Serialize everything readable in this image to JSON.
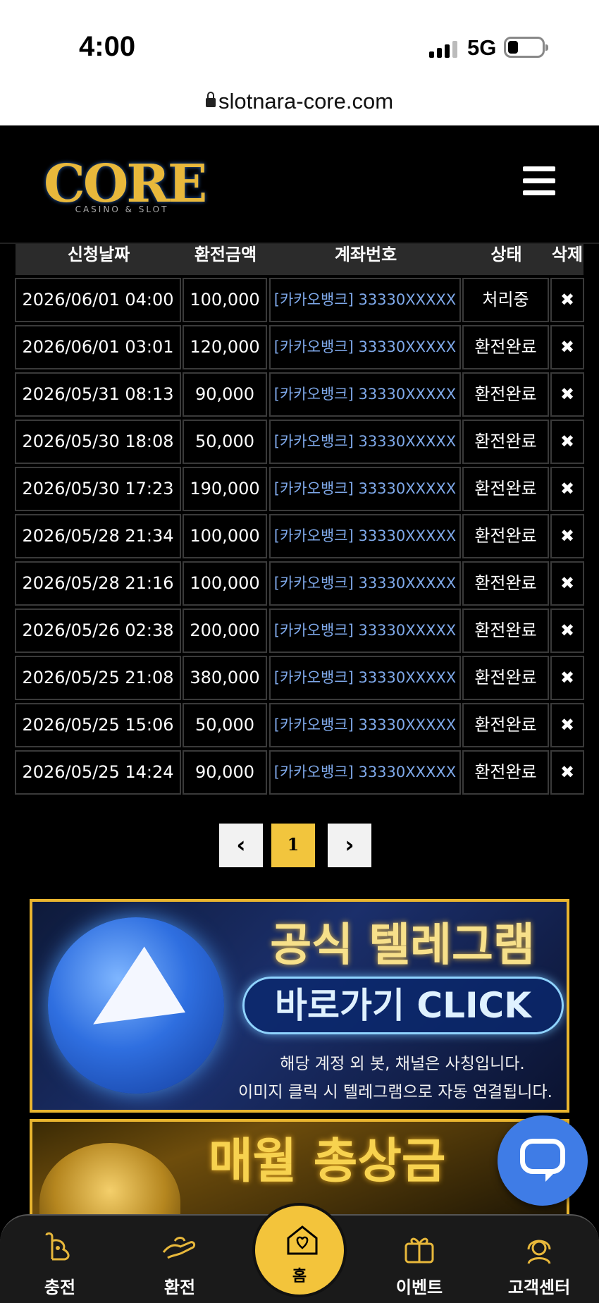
{
  "status_bar": {
    "time": "4:00",
    "network": "5G"
  },
  "browser": {
    "url": "slotnara-core.com"
  },
  "header": {
    "logo_text": "CORE",
    "logo_subtitle": "CASINO & SLOT"
  },
  "table": {
    "columns": [
      "신청날짜",
      "환전금액",
      "계좌번호",
      "상태",
      "삭제"
    ],
    "rows": [
      {
        "date": "2026/06/01 04:00",
        "amount": "100,000",
        "account": "[카카오뱅크] 33330XXXXX",
        "status": "처리중"
      },
      {
        "date": "2026/06/01 03:01",
        "amount": "120,000",
        "account": "[카카오뱅크] 33330XXXXX",
        "status": "환전완료"
      },
      {
        "date": "2026/05/31 08:13",
        "amount": "90,000",
        "account": "[카카오뱅크] 33330XXXXX",
        "status": "환전완료"
      },
      {
        "date": "2026/05/30 18:08",
        "amount": "50,000",
        "account": "[카카오뱅크] 33330XXXXX",
        "status": "환전완료"
      },
      {
        "date": "2026/05/30 17:23",
        "amount": "190,000",
        "account": "[카카오뱅크] 33330XXXXX",
        "status": "환전완료"
      },
      {
        "date": "2026/05/28 21:34",
        "amount": "100,000",
        "account": "[카카오뱅크] 33330XXXXX",
        "status": "환전완료"
      },
      {
        "date": "2026/05/28 21:16",
        "amount": "100,000",
        "account": "[카카오뱅크] 33330XXXXX",
        "status": "환전완료"
      },
      {
        "date": "2026/05/26 02:38",
        "amount": "200,000",
        "account": "[카카오뱅크] 33330XXXXX",
        "status": "환전완료"
      },
      {
        "date": "2026/05/25 21:08",
        "amount": "380,000",
        "account": "[카카오뱅크] 33330XXXXX",
        "status": "환전완료"
      },
      {
        "date": "2026/05/25 15:06",
        "amount": "50,000",
        "account": "[카카오뱅크] 33330XXXXX",
        "status": "환전완료"
      },
      {
        "date": "2026/05/25 14:24",
        "amount": "90,000",
        "account": "[카카오뱅크] 33330XXXXX",
        "status": "환전완료"
      }
    ],
    "delete_icon": "close-icon"
  },
  "pagination": {
    "prev": "‹",
    "current": "1",
    "next": "›"
  },
  "banners": {
    "telegram": {
      "title": "공식 텔레그램",
      "button": "바로가기 CLICK",
      "note1": "해당 계정 외 봇, 채널은 사칭입니다.",
      "note2": "이미지 클릭 시 텔레그램으로 자동 연결됩니다."
    },
    "monthly": {
      "title": "매월 총상금"
    }
  },
  "bottom_nav": {
    "charge": "충전",
    "exchange": "환전",
    "home": "홈",
    "event": "이벤트",
    "support": "고객센터"
  },
  "colors": {
    "accent": "#f3c43b",
    "account_text": "#7fa9ea",
    "chat": "#3f7ce6"
  }
}
